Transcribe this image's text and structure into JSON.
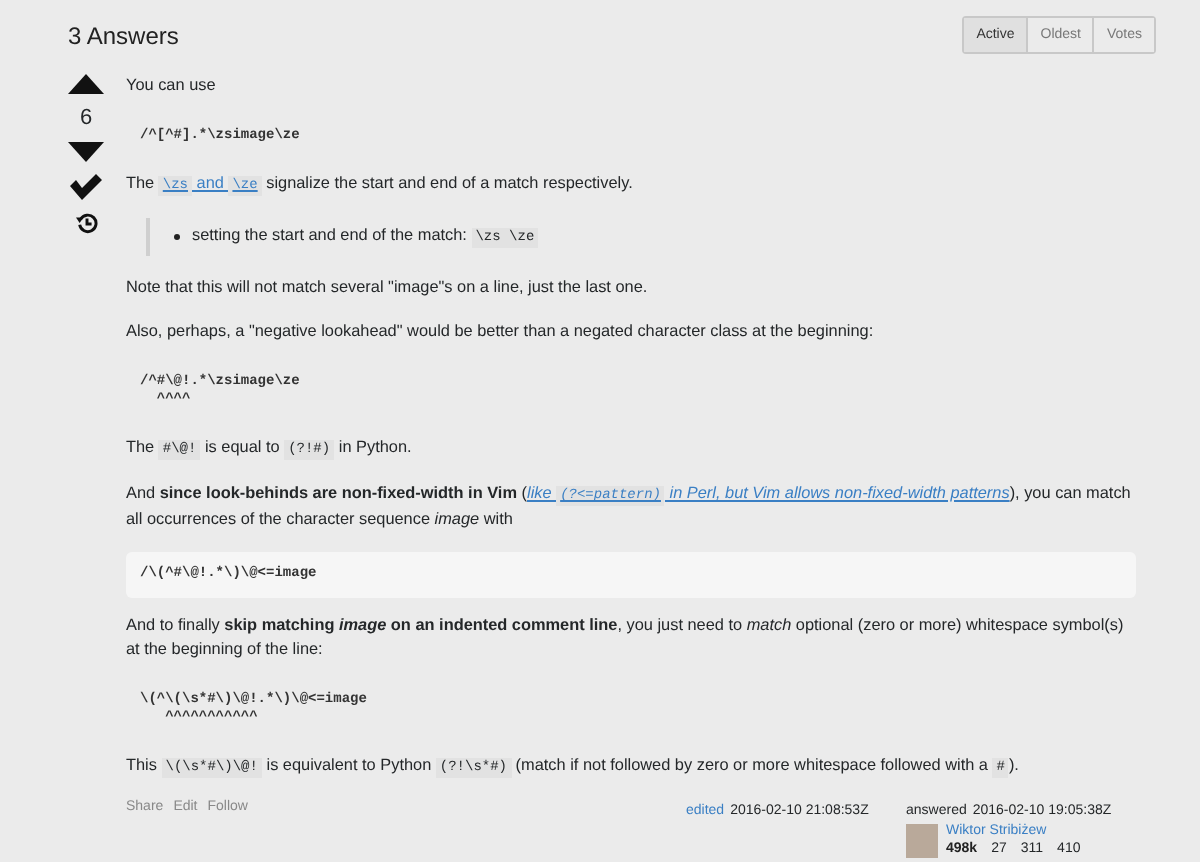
{
  "header": {
    "title": "3 Answers",
    "sort_tabs": [
      {
        "label": "Active",
        "selected": true
      },
      {
        "label": "Oldest",
        "selected": false
      },
      {
        "label": "Votes",
        "selected": false
      }
    ]
  },
  "votes": {
    "score": "6"
  },
  "body": [
    {
      "kind": "paragraph",
      "parts": [
        {
          "kind": "text",
          "text": "You can use"
        }
      ]
    },
    {
      "kind": "code",
      "text": "/^[^#].*\\zsimage\\ze"
    },
    {
      "kind": "paragraph",
      "parts": [
        {
          "kind": "text",
          "text": "The "
        },
        {
          "kind": "link",
          "italic": false,
          "parts": [
            {
              "kind": "code",
              "text": "\\zs"
            },
            {
              "kind": "text",
              "text": " and "
            },
            {
              "kind": "code",
              "text": "\\ze"
            }
          ]
        },
        {
          "kind": "text",
          "text": " signalize the start and end of a match respectively."
        }
      ]
    },
    {
      "kind": "quote",
      "items": [
        {
          "parts": [
            {
              "kind": "text",
              "text": "setting the start and end of the match: "
            },
            {
              "kind": "code",
              "text": "\\zs \\ze"
            }
          ]
        }
      ]
    },
    {
      "kind": "paragraph",
      "parts": [
        {
          "kind": "text",
          "text": "Note that this will not match several \"image\"s on a line, just the last one."
        }
      ]
    },
    {
      "kind": "paragraph",
      "parts": [
        {
          "kind": "text",
          "text": "Also, perhaps, a \"negative lookahead\" would be better than a negated character class at the beginning:"
        }
      ]
    },
    {
      "kind": "code",
      "text": "/^#\\@!.*\\zsimage\\ze\n  ^^^^"
    },
    {
      "kind": "paragraph",
      "parts": [
        {
          "kind": "text",
          "text": "The "
        },
        {
          "kind": "code",
          "text": "#\\@!"
        },
        {
          "kind": "text",
          "text": " is equal to "
        },
        {
          "kind": "code",
          "text": "(?!#)"
        },
        {
          "kind": "text",
          "text": " in Python."
        }
      ]
    },
    {
      "kind": "paragraph",
      "parts": [
        {
          "kind": "text",
          "text": "And **since look-behinds are non-fixed-width in Vim** ("
        },
        {
          "kind": "link",
          "italic": true,
          "parts": [
            {
              "kind": "text",
              "text": "like "
            },
            {
              "kind": "code",
              "text": "(?<=pattern)"
            },
            {
              "kind": "text",
              "text": " in Perl, but Vim allows non-fixed-width patterns"
            }
          ]
        },
        {
          "kind": "text",
          "text": "), you can match all occurrences of the character sequence *image* with"
        }
      ]
    },
    {
      "kind": "codebox",
      "text": "/\\(^#\\@!.*\\)\\@<=image"
    },
    {
      "kind": "paragraph",
      "parts": [
        {
          "kind": "text",
          "text": "And to finally "
        },
        {
          "kind": "bold",
          "text": "skip matching "
        },
        {
          "kind": "bolditalic",
          "text": "image"
        },
        {
          "kind": "bold",
          "text": " on an indented comment line"
        },
        {
          "kind": "text",
          "text": ", you just need to *match* optional (zero or more) whitespace symbol(s) at the beginning of the line:"
        }
      ]
    },
    {
      "kind": "code",
      "text": "\\(^\\(\\s*#\\)\\@!.*\\)\\@<=image\n   ^^^^^^^^^^^"
    },
    {
      "kind": "paragraph",
      "parts": [
        {
          "kind": "text",
          "text": "This "
        },
        {
          "kind": "code",
          "text": "\\(\\s*#\\)\\@!"
        },
        {
          "kind": "text",
          "text": " is equivalent to Python "
        },
        {
          "kind": "code",
          "text": "(?!\\s*#)"
        },
        {
          "kind": "text",
          "text": " (match if not followed by zero or more whitespace followed with a "
        },
        {
          "kind": "code",
          "text": "#"
        },
        {
          "kind": "text",
          "text": ")."
        }
      ]
    }
  ],
  "footer": {
    "actions": [
      "Share",
      "Edit",
      "Follow"
    ],
    "edited": {
      "link": "edited",
      "time": "2016-02-10 21:08:53Z"
    },
    "answered": {
      "label": "answered",
      "time": "2016-02-10 19:05:38Z",
      "user": "Wiktor Stribiżew",
      "reputation": "498k",
      "badges": [
        "27",
        "311",
        "410"
      ]
    }
  }
}
